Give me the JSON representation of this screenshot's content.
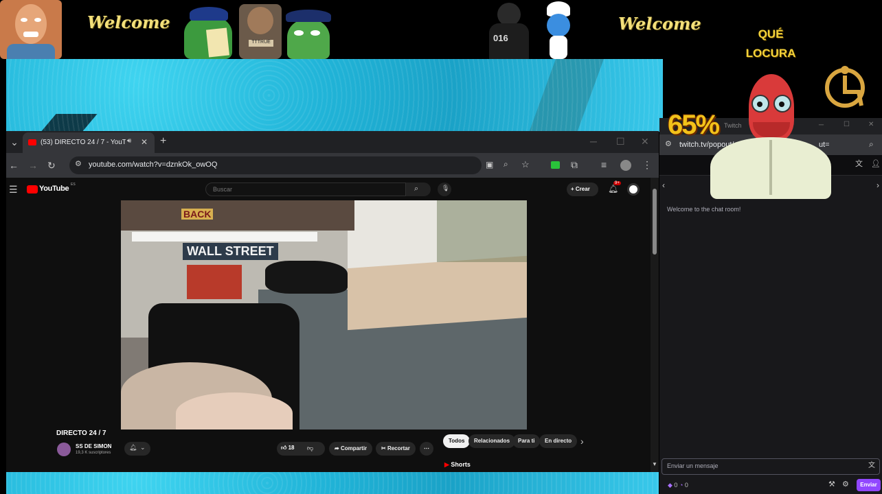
{
  "overlay": {
    "welcome_left": "Welcome",
    "welcome_right": "Welcome",
    "que_locura_line1": "QUÉ",
    "que_locura_line2": "LOCURA",
    "percent": "65%",
    "sticker_label_016": "016"
  },
  "browser": {
    "tab_title": "(53) DIRECTO 24 / 7 - YouTu",
    "new_tab_icon": "plus-icon",
    "url": "youtube.com/watch?v=dznkOk_owOQ"
  },
  "youtube": {
    "logo_text": "YouTube",
    "logo_sup": "ES",
    "search_placeholder": "Buscar",
    "create_label": "Crear",
    "notif_count": "9+",
    "video_sign_wall_street": "WALL STREET",
    "video_sign_back": "BACK",
    "video_title": "DIRECTO 24 / 7",
    "channel_name": "SS DE SIMON",
    "subscribers": "19,3 K suscriptores",
    "likes": "18",
    "share_label": "Compartir",
    "clip_label": "Recortar",
    "chips": [
      "Todos",
      "Relacionados",
      "Para ti",
      "En directo"
    ],
    "shorts_label": "Shorts"
  },
  "twitch": {
    "url": "twitch.tv/popout/",
    "url_suffix": "ut=",
    "title_partial": "Twitch",
    "welcome_message": "Welcome to the chat room!",
    "input_placeholder": "Enviar un mensaje",
    "points_a": "0",
    "points_b": "0",
    "send_label": "Enviar"
  },
  "colors": {
    "yt_red": "#ff0000",
    "twitch_purple": "#9147ff",
    "paint_blue": "#21b4d8",
    "welcome_gold": "#f3e07a"
  }
}
